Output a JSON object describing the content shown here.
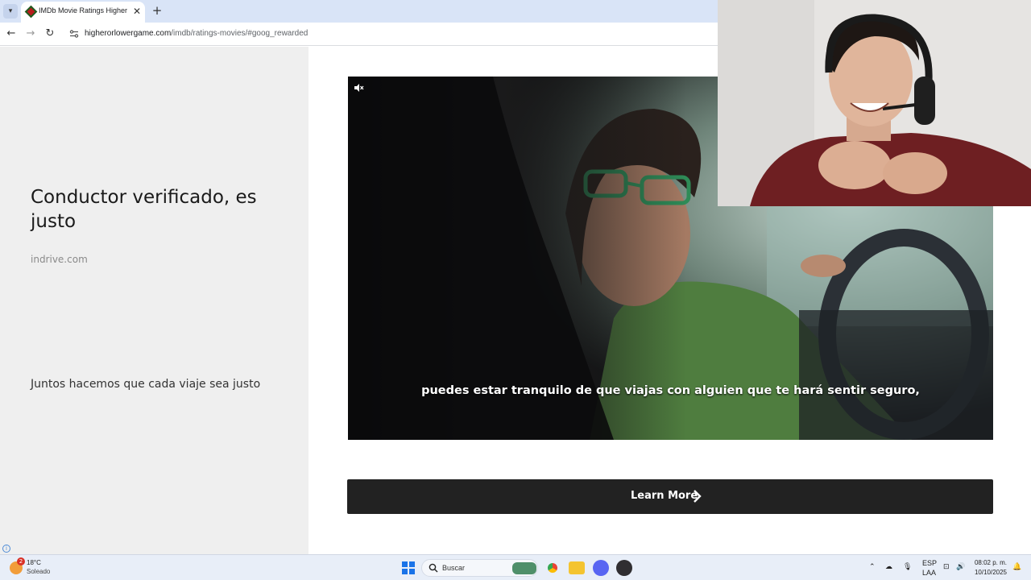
{
  "browser": {
    "tab_title": "IMDb Movie Ratings Higher or",
    "tab_close": "✕",
    "new_tab": "+",
    "url_host": "higherorlowergame.com",
    "url_path": "/imdb/ratings-movies/#goog_rewarded"
  },
  "ad": {
    "headline": "Conductor verificado, es justo",
    "domain": "indrive.com",
    "description": "Juntos hacemos que cada viaje sea justo",
    "video_subtitle": "puedes estar tranquilo de que viajas con alguien que te hará sentir seguro,",
    "cta_label": "Learn More"
  },
  "taskbar": {
    "weather_badge": "2",
    "weather_temp": "18°C",
    "weather_condition": "Soleado",
    "search_label": "Buscar",
    "input_lang": "ESP",
    "input_layout": "LAA",
    "clock_time": "08:02 p. m.",
    "clock_date": "10/10/2025"
  },
  "icons": [
    "tab-list-icon",
    "back-icon",
    "forward-icon",
    "reload-icon",
    "site-info-icon",
    "mute-icon",
    "chevron-right-icon",
    "windows-start-icon",
    "search-icon",
    "chrome-icon",
    "file-explorer-icon",
    "discord-icon",
    "obs-icon",
    "wifi-icon",
    "speaker-icon",
    "mic-icon",
    "notification-icon"
  ]
}
